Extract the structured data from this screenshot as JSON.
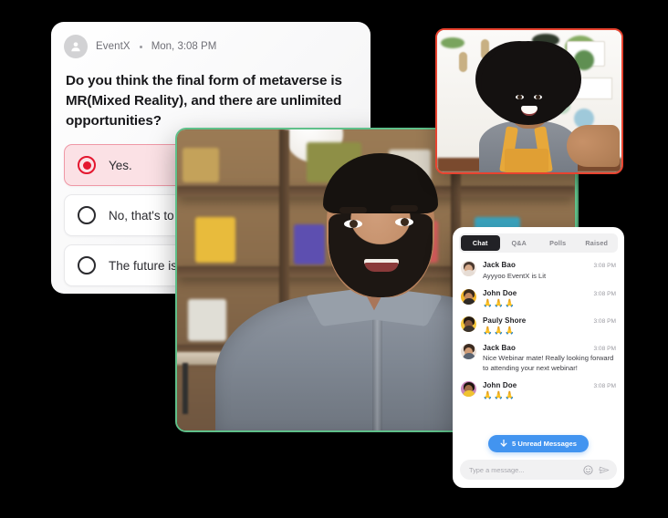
{
  "poll": {
    "author": "EventX",
    "separator": "•",
    "timestamp": "Mon, 3:08 PM",
    "avatar_icon": "person-avatar-icon",
    "question": "Do you think the final form of metaverse is MR(Mixed Reality), and there are unlimited opportunities?",
    "options": [
      {
        "label": "Yes.",
        "selected": true
      },
      {
        "label": "No, that's to",
        "selected": false
      },
      {
        "label": "The future is",
        "selected": false
      }
    ],
    "selected_color": "#e4172f",
    "selected_bg": "#fbe1e5"
  },
  "main_video": {
    "border_color": "#5fc08a",
    "label": "presenter-video"
  },
  "webcam": {
    "border_color": "#e8432f",
    "label": "participant-video"
  },
  "背景_tile": {
    "border_color": "#5fc08a"
  },
  "chat": {
    "tabs": [
      {
        "label": "Chat",
        "active": true
      },
      {
        "label": "Q&A",
        "active": false
      },
      {
        "label": "Polls",
        "active": false
      },
      {
        "label": "Raised",
        "active": false
      }
    ],
    "messages": [
      {
        "name": "Jack Bao",
        "time": "3:08 PM",
        "text": "Ayyyoo EventX is Lit",
        "emoji": ""
      },
      {
        "name": "John Doe",
        "time": "3:08 PM",
        "text": "",
        "emoji": "🙏🙏🙏"
      },
      {
        "name": "Pauly Shore",
        "time": "3:08 PM",
        "text": "",
        "emoji": "🙏🙏🙏"
      },
      {
        "name": "Jack Bao",
        "time": "3:08 PM",
        "text": "Nice Webinar mate! Really looking forward to attending your next webinar!",
        "emoji": ""
      },
      {
        "name": "John Doe",
        "time": "3:08 PM",
        "text": "",
        "emoji": "🙏🙏🙏"
      }
    ],
    "unread": {
      "label": "5 Unread Messages",
      "arrow_icon": "arrow-down-icon",
      "color": "#4294f0"
    },
    "composer": {
      "placeholder": "Type a message...",
      "value": "",
      "emoji_icon": "emoji-smiley-icon",
      "send_icon": "send-paper-plane-icon"
    }
  }
}
